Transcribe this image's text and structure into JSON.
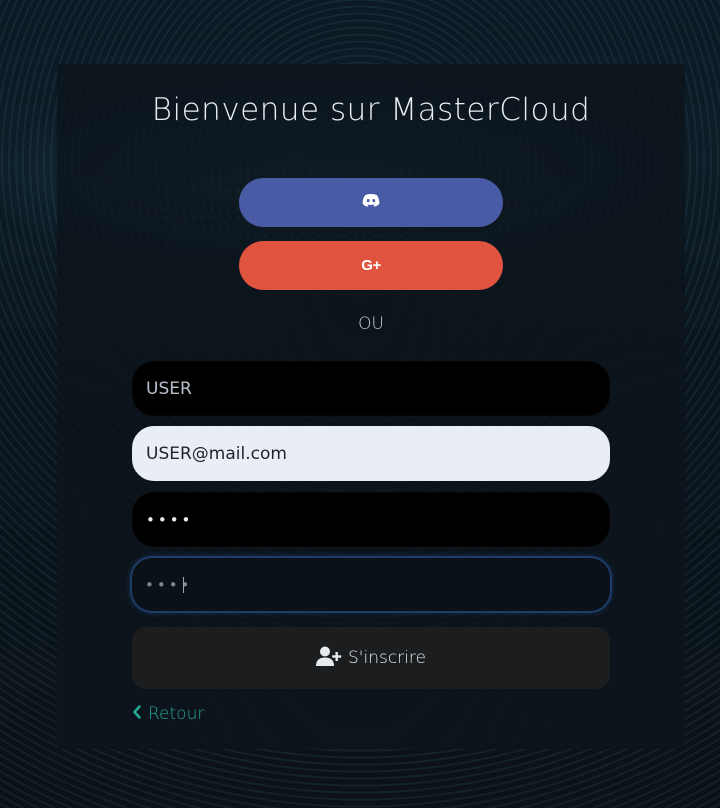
{
  "header": {
    "title": "Bienvenue sur MasterCloud"
  },
  "oauth": {
    "discord": {
      "icon": "discord-icon"
    },
    "google": {
      "icon": "google-plus-icon",
      "glyph": "G+"
    }
  },
  "divider": {
    "label": "OU"
  },
  "form": {
    "username": {
      "value": "USER"
    },
    "email": {
      "value": "USER@mail.com"
    },
    "password": {
      "value": "••••"
    },
    "confirm_password": {
      "value": "••••"
    }
  },
  "submit": {
    "label": "S'inscrire",
    "icon": "user-plus-icon"
  },
  "back": {
    "label": "Retour",
    "icon": "chevron-left-icon"
  },
  "colors": {
    "discord": "#4a5ba6",
    "google": "#e0533f",
    "link": "#27a69a",
    "focus_border": "#1b3d66"
  }
}
